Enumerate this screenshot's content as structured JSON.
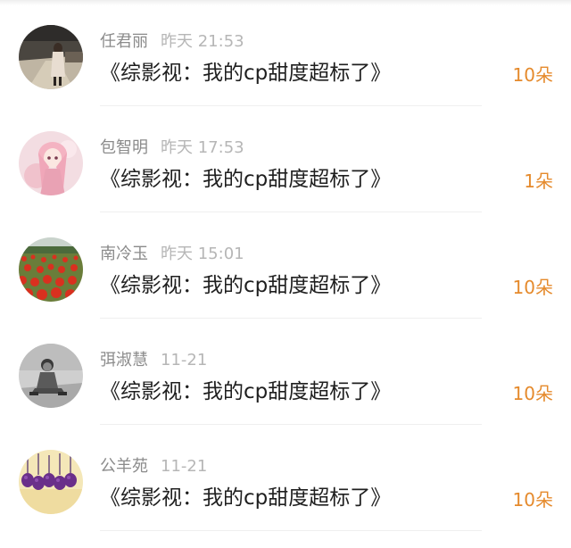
{
  "rows": [
    {
      "user": "任君丽",
      "time": "昨天 21:53",
      "title": "《综影视：我的cp甜度超标了》",
      "flowers": "10朵",
      "avatar": "girl-on-road-avatar"
    },
    {
      "user": "包智明",
      "time": "昨天 17:53",
      "title": "《综影视：我的cp甜度超标了》",
      "flowers": "1朵",
      "avatar": "anime-girl-avatar"
    },
    {
      "user": "南冷玉",
      "time": "昨天 15:01",
      "title": "《综影视：我的cp甜度超标了》",
      "flowers": "10朵",
      "avatar": "poppy-field-avatar"
    },
    {
      "user": "弭淑慧",
      "time": "11-21",
      "title": "《综影视：我的cp甜度超标了》",
      "flowers": "10朵",
      "avatar": "child-sitting-avatar"
    },
    {
      "user": "公羊苑",
      "time": "11-21",
      "title": "《综影视：我的cp甜度超标了》",
      "flowers": "10朵",
      "avatar": "hanging-flowers-avatar"
    }
  ],
  "colors": {
    "flower_count": "#e58a2c",
    "username": "#8b8b8b",
    "timestamp": "#b6b6b6",
    "title": "#1f1f1f"
  }
}
